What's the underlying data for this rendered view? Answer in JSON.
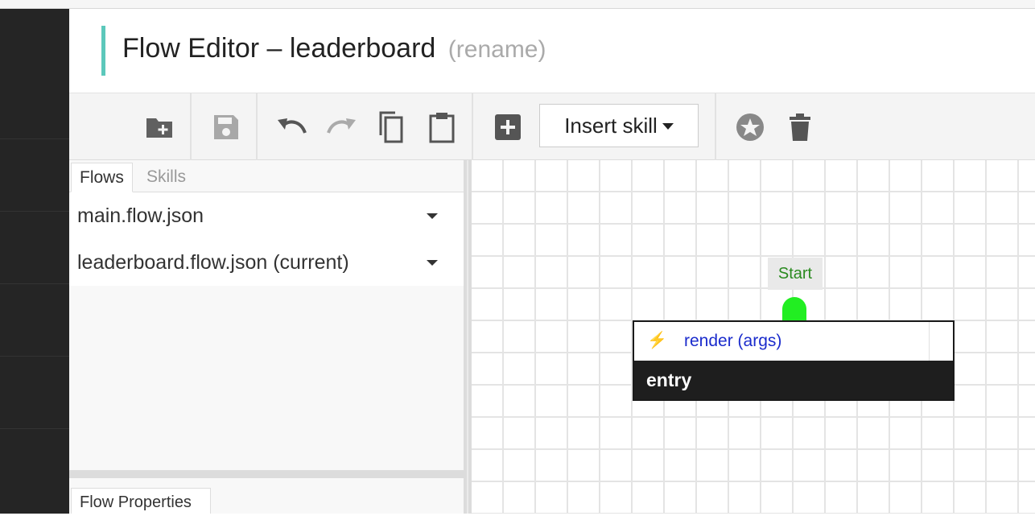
{
  "header": {
    "title": "Flow Editor – leaderboard",
    "rename_link": "(rename)",
    "accent_color": "#5cc8bb"
  },
  "toolbar": {
    "icons": [
      "new-folder-icon",
      "save-icon",
      "undo-icon",
      "redo-icon",
      "copy-icon",
      "paste-icon",
      "add-node-icon",
      "star-icon",
      "trash-icon"
    ],
    "insert_skill_label": "Insert skill"
  },
  "sidebar": {
    "tabs": [
      {
        "label": "Flows",
        "active": true
      },
      {
        "label": "Skills",
        "active": false
      }
    ],
    "flows": [
      {
        "label": "main.flow.json"
      },
      {
        "label": "leaderboard.flow.json (current)"
      }
    ],
    "properties_tab": "Flow Properties"
  },
  "canvas": {
    "start_label": "Start",
    "start_color": "#22ee22",
    "node": {
      "action_label": "render (args)",
      "name": "entry"
    }
  }
}
